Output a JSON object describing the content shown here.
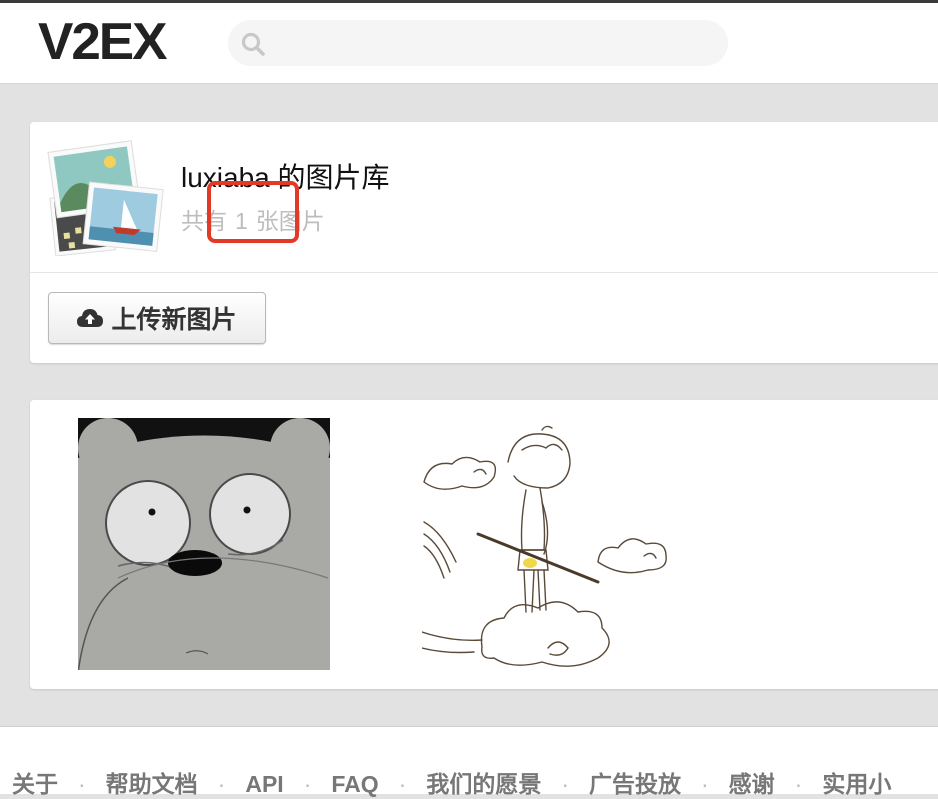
{
  "header": {
    "logo_text": "V2EX",
    "search_placeholder": ""
  },
  "gallery": {
    "title": "luxiaba 的图片库",
    "count_prefix": "共有",
    "count_value": "1",
    "count_suffix": "张图片",
    "upload_label": "上传新图片",
    "annotation_color": "#e23a26"
  },
  "images": [
    {
      "name": "bear-face-image"
    },
    {
      "name": "boy-on-cloud-sketch-image"
    }
  ],
  "footer": {
    "links": [
      "关于",
      "帮助文档",
      "API",
      "FAQ",
      "我们的愿景",
      "广告投放",
      "感谢",
      "实用小"
    ]
  }
}
